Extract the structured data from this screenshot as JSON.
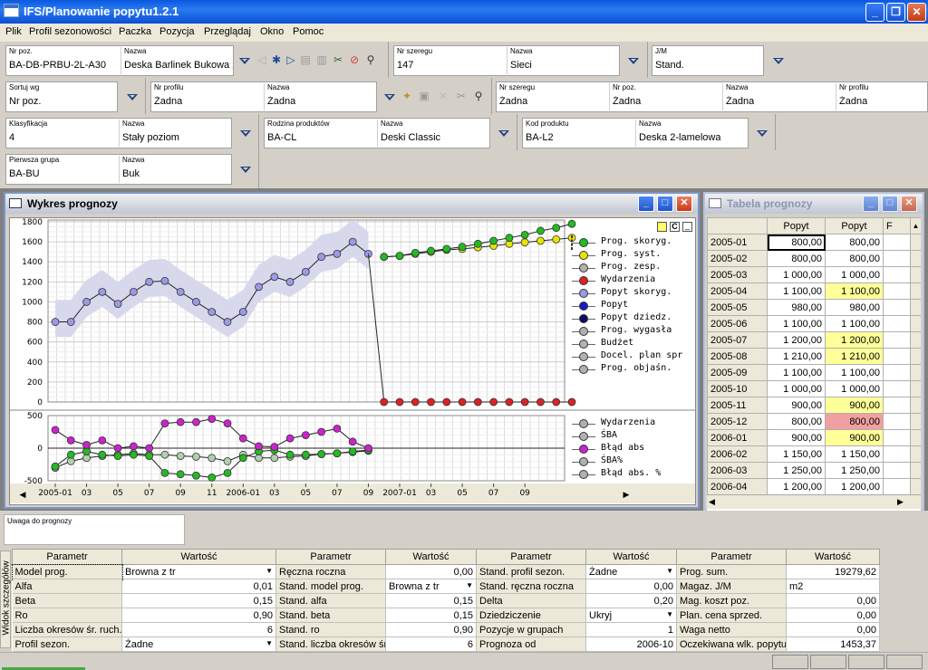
{
  "app": {
    "title": "IFS/Planowanie popytu1.2.1"
  },
  "menu": [
    "Plik",
    "Profil sezonowości",
    "Paczka",
    "Pozycja",
    "Przeglądaj",
    "Okno",
    "Pomoc"
  ],
  "filters": {
    "nr_poz": {
      "label": "Nr poz.",
      "value": "BA-DB-PRBU-2L-A30"
    },
    "nazwa1": {
      "label": "Nazwa",
      "value": "Deska Barlinek Bukowa 2"
    },
    "nr_szeregu": {
      "label": "Nr szeregu",
      "value": "147"
    },
    "nazwa2": {
      "label": "Nazwa",
      "value": "Sieci"
    },
    "jm": {
      "label": "J/M",
      "value": "Stand."
    },
    "sortuj": {
      "label": "Sortuj wg",
      "value": "Nr poz."
    },
    "nr_profilu": {
      "label": "Nr profilu",
      "value": "Żadna"
    },
    "nazwa3": {
      "label": "Nazwa",
      "value": "Żadna"
    },
    "r_nr_szeregu": {
      "label": "Nr szeregu",
      "value": "Żadna"
    },
    "r_nr_poz": {
      "label": "Nr poz.",
      "value": "Żadna"
    },
    "r_nazwa": {
      "label": "Nazwa",
      "value": "Żadna"
    },
    "r_nr_profilu": {
      "label": "Nr profilu",
      "value": "Żadna"
    },
    "klasyfikacja": {
      "label": "Klasyfikacja",
      "value": "4"
    },
    "nazwa4": {
      "label": "Nazwa",
      "value": "Stały poziom"
    },
    "rodzina": {
      "label": "Rodzina produktów",
      "value": "BA-CL"
    },
    "nazwa5": {
      "label": "Nazwa",
      "value": "Deski Classic"
    },
    "kod": {
      "label": "Kod produktu",
      "value": "BA-L2"
    },
    "nazwa6": {
      "label": "Nazwa",
      "value": "Deska 2-lamelowa"
    },
    "grupa": {
      "label": "Pierwsza grupa",
      "value": "BA-BU"
    },
    "nazwa7": {
      "label": "Nazwa",
      "value": "Buk"
    }
  },
  "chart_window": {
    "title": "Wykres prognozy"
  },
  "table_window": {
    "title": "Tabela prognozy",
    "headers": [
      "Popyt",
      "Popyt",
      "F"
    ],
    "rows": [
      {
        "period": "2005-01",
        "a": "800,00",
        "b": "800,00",
        "hl": ""
      },
      {
        "period": "2005-02",
        "a": "800,00",
        "b": "800,00",
        "hl": ""
      },
      {
        "period": "2005-03",
        "a": "1 000,00",
        "b": "1 000,00",
        "hl": ""
      },
      {
        "period": "2005-04",
        "a": "1 100,00",
        "b": "1 100,00",
        "hl": "#ffff99"
      },
      {
        "period": "2005-05",
        "a": "980,00",
        "b": "980,00",
        "hl": ""
      },
      {
        "period": "2005-06",
        "a": "1 100,00",
        "b": "1 100,00",
        "hl": ""
      },
      {
        "period": "2005-07",
        "a": "1 200,00",
        "b": "1 200,00",
        "hl": "#ffff99"
      },
      {
        "period": "2005-08",
        "a": "1 210,00",
        "b": "1 210,00",
        "hl": "#ffff99"
      },
      {
        "period": "2005-09",
        "a": "1 100,00",
        "b": "1 100,00",
        "hl": ""
      },
      {
        "period": "2005-10",
        "a": "1 000,00",
        "b": "1 000,00",
        "hl": ""
      },
      {
        "period": "2005-11",
        "a": "900,00",
        "b": "900,00",
        "hl": "#ffff99"
      },
      {
        "period": "2005-12",
        "a": "800,00",
        "b": "800,00",
        "hl": "#f0a0a0"
      },
      {
        "period": "2006-01",
        "a": "900,00",
        "b": "900,00",
        "hl": "#ffff99"
      },
      {
        "period": "2006-02",
        "a": "1 150,00",
        "b": "1 150,00",
        "hl": ""
      },
      {
        "period": "2006-03",
        "a": "1 250,00",
        "b": "1 250,00",
        "hl": ""
      },
      {
        "period": "2006-04",
        "a": "1 200,00",
        "b": "1 200,00",
        "hl": ""
      }
    ]
  },
  "uwaga": {
    "label": "Uwaga do prognozy"
  },
  "side_tab": "Widok szczegółów",
  "params": {
    "headers": [
      "Parametr",
      "Wartość",
      "Parametr",
      "Wartość",
      "Parametr",
      "Wartość",
      "Parametr",
      "Wartość"
    ],
    "rows": [
      [
        "Model prog.",
        "Brownа z tr",
        "Ręczna roczna",
        "0,00",
        "Stand. profil sezon.",
        "Żadne",
        "Prog. sum.",
        "19279,62"
      ],
      [
        "Alfa",
        "0,01",
        "Stand. model prog.",
        "Browna z tr",
        "Stand. ręczna roczna",
        "0,00",
        "Magaz. J/M",
        "m2"
      ],
      [
        "Beta",
        "0,15",
        "Stand. alfa",
        "0,15",
        "Delta",
        "0,20",
        "Mag. koszt poz.",
        "0,00"
      ],
      [
        "Ro",
        "0,90",
        "Stand. beta",
        "0,15",
        "Dziedziczenie",
        "Ukryj",
        "Plan. cena sprzed.",
        "0,00"
      ],
      [
        "Liczba okresów śr. ruch.",
        "6",
        "Stand. ro",
        "0,90",
        "Pozycje w grupach",
        "1",
        "Waga netto",
        "0,00"
      ],
      [
        "Profil sezon.",
        "Żadne",
        "Stand. liczba okresów śr",
        "6",
        "Prognoza od",
        "2006-10",
        "Oczekiwana wlk. popytu",
        "1453,37"
      ]
    ]
  },
  "chart_data": [
    {
      "type": "line",
      "x_ticks": [
        "2005-01",
        "03",
        "05",
        "07",
        "09",
        "11",
        "2006-01",
        "03",
        "05",
        "07",
        "09",
        "2007-01",
        "03",
        "05",
        "07",
        "09"
      ],
      "ylim": [
        0,
        1800
      ],
      "y_ticks": [
        "0",
        "200",
        "400",
        "600",
        "800",
        "1000",
        "1200",
        "1400",
        "1600",
        "1800"
      ],
      "series": [
        {
          "name": "Popyt skoryg.",
          "color": "#9a9ae6",
          "values": [
            800,
            800,
            1000,
            1100,
            980,
            1100,
            1200,
            1210,
            1100,
            1000,
            900,
            800,
            900,
            1150,
            1250,
            1200,
            1300,
            1450,
            1480,
            1600,
            1480
          ]
        },
        {
          "name": "Prog. skoryg.",
          "color": "#22bb22",
          "values": [
            1450,
            1460,
            1490,
            1510,
            1530,
            1550,
            1580,
            1610,
            1640,
            1670,
            1710,
            1740,
            1780
          ]
        },
        {
          "name": "Prog. syst.",
          "color": "#e6e600",
          "values": [
            1450,
            1460,
            1480,
            1500,
            1520,
            1530,
            1545,
            1560,
            1580,
            1595,
            1610,
            1625,
            1640
          ]
        },
        {
          "name": "Wydarzenia",
          "color": "#dd2222",
          "values": [
            0,
            0,
            0,
            0,
            0,
            0,
            0,
            0,
            0,
            0,
            0,
            0,
            0
          ]
        }
      ],
      "legend": [
        "Prog. skoryg.",
        "Prog. syst.",
        "Prog. zesp.",
        "Wydarzenia",
        "Popyt skoryg.",
        "Popyt",
        "Popyt dziedz.",
        "Prog. wygasła",
        "Budżet",
        "Docel. plan spr",
        "Prog. objaśn."
      ],
      "legend_colors": [
        "#22bb22",
        "#e6e600",
        "#b0b0b0",
        "#dd2222",
        "#9a9ae6",
        "#1a1acc",
        "#0a0a66",
        "#b0b0b0",
        "#b0b0b0",
        "#b0b0b0",
        "#b0b0b0"
      ]
    },
    {
      "type": "line",
      "ylim": [
        -500,
        500
      ],
      "y_ticks": [
        "-500",
        "0",
        "500"
      ],
      "series": [
        {
          "name": "Błąd abs",
          "color": "#cc22cc",
          "values": [
            280,
            120,
            50,
            120,
            0,
            30,
            0,
            380,
            400,
            400,
            450,
            380,
            150,
            30,
            20,
            150,
            200,
            250,
            300,
            100,
            0
          ]
        },
        {
          "name": "ŚBA",
          "color": "#22bb22",
          "values": [
            -280,
            -100,
            -50,
            -100,
            -120,
            -100,
            -120,
            -380,
            -400,
            -420,
            -450,
            -380,
            -150,
            -50,
            -30,
            -100,
            -100,
            -90,
            -80,
            -50,
            -30
          ]
        },
        {
          "name": "ŚBA%",
          "color": "#b0d0b0",
          "values": [
            -300,
            -200,
            -150,
            -120,
            -100,
            -80,
            -100,
            -100,
            -120,
            -130,
            -150,
            -200,
            -100,
            -150,
            -150,
            -130,
            -120,
            -90,
            -80,
            -60,
            -40
          ]
        }
      ],
      "legend": [
        "Wydarzenia",
        "ŚBA",
        "Błąd abs",
        "ŚBA%",
        "Błąd abs. %"
      ],
      "legend_colors": [
        "#b0b0b0",
        "#b0b0b0",
        "#cc22cc",
        "#b0b0b0",
        "#b0b0b0"
      ]
    }
  ]
}
